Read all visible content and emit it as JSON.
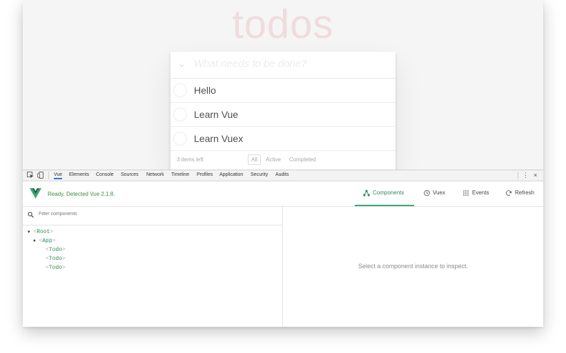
{
  "todo": {
    "title": "todos",
    "new_placeholder": "What needs to be done?",
    "items": [
      {
        "label": "Hello",
        "completed": false
      },
      {
        "label": "Learn Vue",
        "completed": false
      },
      {
        "label": "Learn Vuex",
        "completed": false
      }
    ],
    "footer": {
      "count": "3 items left",
      "filters": [
        "All",
        "Active",
        "Completed"
      ],
      "selected": "All"
    }
  },
  "devtools": {
    "tabs": [
      "Vue",
      "Elements",
      "Console",
      "Sources",
      "Network",
      "Timeline",
      "Profiles",
      "Application",
      "Security",
      "Audits"
    ],
    "active_tab": "Vue",
    "menu_glyph": "⋮",
    "close_glyph": "×",
    "vue": {
      "status": "Ready. Detected Vue 2.1.8.",
      "logo_color": "#2c8a5f",
      "accent_color": "#3aa876",
      "tabs": [
        {
          "label": "Components",
          "icon": "components-icon",
          "active": true
        },
        {
          "label": "Vuex",
          "icon": "history-icon",
          "active": false
        },
        {
          "label": "Events",
          "icon": "events-icon",
          "active": false
        },
        {
          "label": "Refresh",
          "icon": "refresh-icon",
          "active": false
        }
      ],
      "filter_placeholder": "Filter components",
      "tree": [
        {
          "name": "Root",
          "expanded": true
        },
        {
          "name": "App",
          "expanded": true
        },
        {
          "name": "Todo"
        },
        {
          "name": "Todo"
        },
        {
          "name": "Todo"
        }
      ],
      "inspect_message": "Select a component instance to inspect."
    }
  }
}
